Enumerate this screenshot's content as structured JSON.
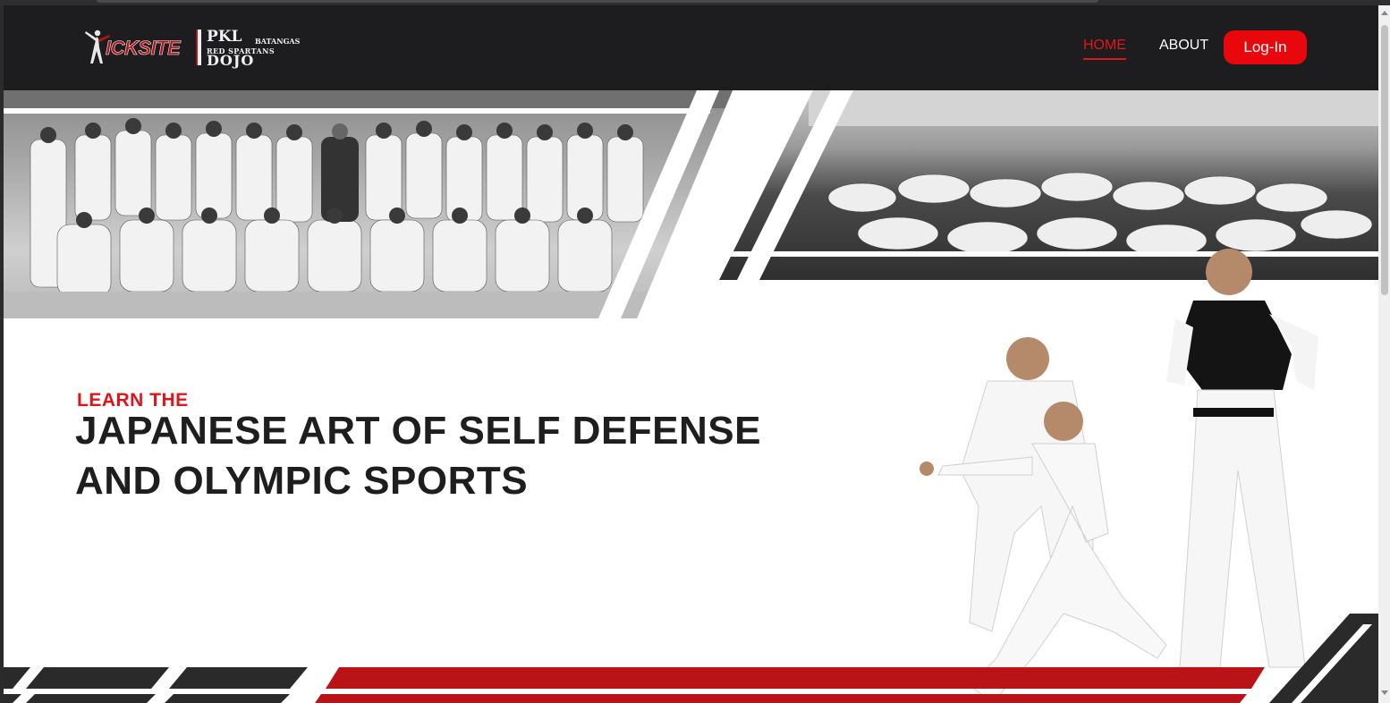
{
  "brand": {
    "word": "ICKSITE",
    "pkl": "PKL",
    "batangas": "BATANGAS",
    "red_spartans": "RED SPARTANS",
    "dojo": "DOJO"
  },
  "nav": {
    "home": "HOME",
    "about": "ABOUT",
    "login": "Log-In"
  },
  "hero": {
    "eyebrow": "LEARN THE",
    "title_line1": "JAPANESE ART OF SELF DEFENSE",
    "title_line2": "AND OLYMPIC SPORTS"
  },
  "colors": {
    "accent": "#e0141b",
    "navbar": "#1d1d1f",
    "text_dark": "#1e1e1e"
  },
  "icons": {
    "logo": "karate-kicker-icon"
  }
}
